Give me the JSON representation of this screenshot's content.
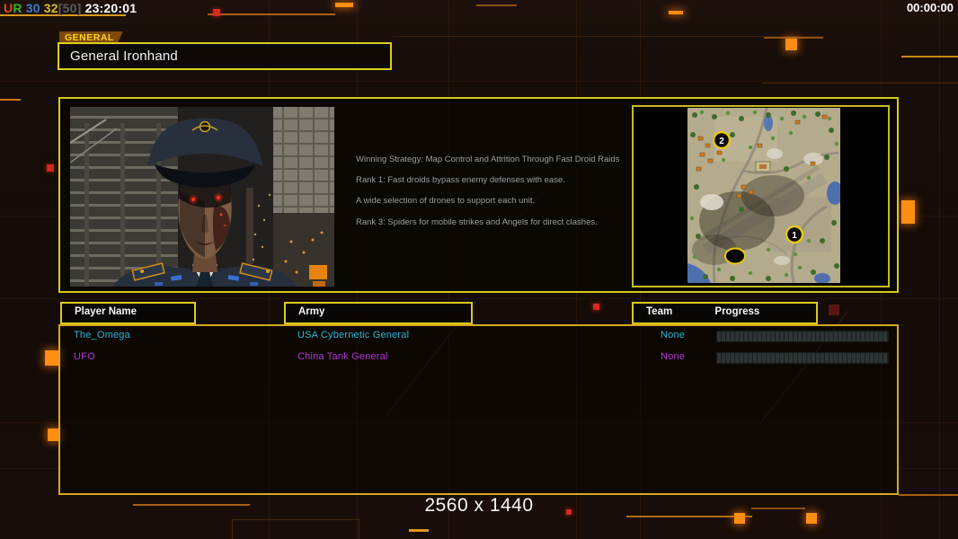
{
  "hud": {
    "ping_letter_1": "U",
    "ping_letter_2": "R",
    "stat_blue": "30",
    "stat_yellow": "32",
    "stat_bracket": "[50]",
    "clock": "23:20:01",
    "match_timer": "00:00:00"
  },
  "general_panel": {
    "tab_label": "GENERAL",
    "general_name": "General Ironhand"
  },
  "strategy": {
    "lines": [
      "Winning Strategy: Map Control and Attrition Through Fast Droid Raids",
      "Rank 1: Fast droids bypass enemy defenses with ease.",
      "A wide selection of drones to support each unit.",
      "Rank 3: Spiders for mobile strikes and Angels for direct clashes."
    ]
  },
  "map_preview": {
    "marker_top": "2",
    "marker_bottom": "1"
  },
  "roster": {
    "headers": {
      "player": "Player Name",
      "army": "Army",
      "team": "Team",
      "progress": "Progress"
    },
    "players": [
      {
        "name": "The_Omega",
        "army": "USA Cybernetic General",
        "team": "None",
        "color": "#25b4d4",
        "progress_percent": 0
      },
      {
        "name": "UFO",
        "army": "China Tank General",
        "team": "None",
        "color": "#b136d6",
        "progress_percent": 0
      }
    ]
  },
  "footer": {
    "resolution": "2560 x 1440"
  },
  "colors": {
    "panel_border_yellow": "#d9cb1f",
    "panel_border_orange": "#d9a81c",
    "circuit_orange": "#ff8d12"
  }
}
